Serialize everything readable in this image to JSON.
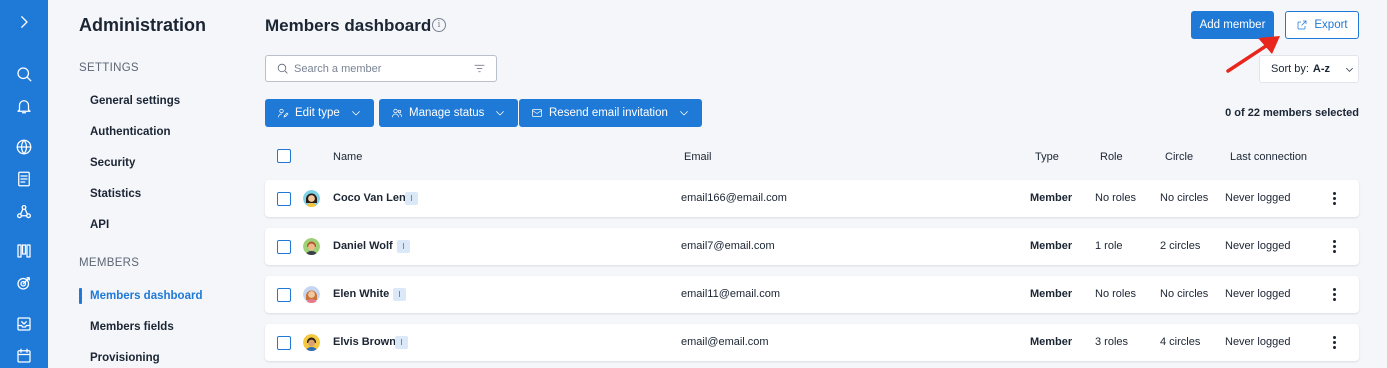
{
  "sidebar": {
    "title": "Administration",
    "sections": [
      {
        "label": "SETTINGS",
        "items": [
          "General settings",
          "Authentication",
          "Security",
          "Statistics",
          "API"
        ]
      },
      {
        "label": "MEMBERS",
        "items": [
          "Members dashboard",
          "Members fields",
          "Provisioning"
        ]
      }
    ],
    "active_item": "Members dashboard"
  },
  "header": {
    "title": "Members dashboard",
    "add_member_label": "Add member",
    "export_label": "Export"
  },
  "search": {
    "placeholder": "Search a member",
    "value": ""
  },
  "sort": {
    "label": "Sort by:",
    "value": "A-z"
  },
  "actions": {
    "edit_type": "Edit type",
    "manage_status": "Manage status",
    "resend_invitation": "Resend email invitation"
  },
  "selected_count": "0 of 22 members selected",
  "table": {
    "columns": {
      "name": "Name",
      "email": "Email",
      "type": "Type",
      "role": "Role",
      "circle": "Circle",
      "last_connection": "Last connection"
    },
    "rows": [
      {
        "name": "Coco Van Len",
        "tag": "I",
        "email": "email166@email.com",
        "type": "Member",
        "role": "No roles",
        "circle": "No circles",
        "last_connection": "Never logged"
      },
      {
        "name": "Daniel Wolf",
        "tag": "I",
        "email": "email7@email.com",
        "type": "Member",
        "role": "1 role",
        "circle": "2 circles",
        "last_connection": "Never logged"
      },
      {
        "name": "Elen White",
        "tag": "I",
        "email": "email11@email.com",
        "type": "Member",
        "role": "No roles",
        "circle": "No circles",
        "last_connection": "Never logged"
      },
      {
        "name": "Elvis Brown",
        "tag": "I",
        "email": "email@email.com",
        "type": "Member",
        "role": "3 roles",
        "circle": "4 circles",
        "last_connection": "Never logged"
      }
    ]
  },
  "colors": {
    "accent": "#1f79d6",
    "annotation_arrow": "#e8261c"
  }
}
